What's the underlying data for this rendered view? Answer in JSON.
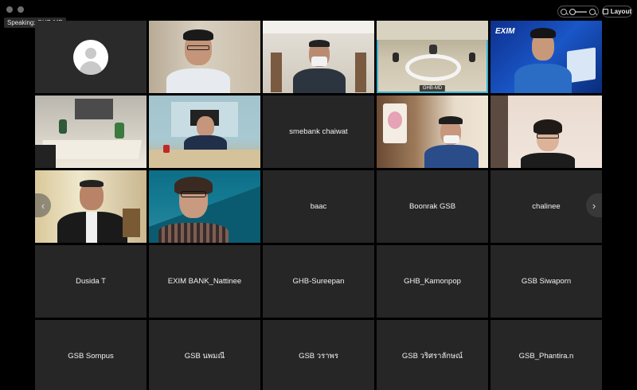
{
  "speaking_indicator": "Speaking: GHB-MD",
  "toolbar": {
    "layout_label": "Layout"
  },
  "tiles": [
    {
      "name": ""
    },
    {
      "name": ""
    },
    {
      "name": ""
    },
    {
      "name": "GHB-MD"
    },
    {
      "name": ""
    },
    {
      "name": ""
    },
    {
      "name": ""
    },
    {
      "name": "smebank chaiwat"
    },
    {
      "name": ""
    },
    {
      "name": ""
    },
    {
      "name": ""
    },
    {
      "name": ""
    },
    {
      "name": "baac"
    },
    {
      "name": "Boonrak GSB"
    },
    {
      "name": "chalinee"
    },
    {
      "name": "Dusida T"
    },
    {
      "name": "EXIM BANK_Nattinee"
    },
    {
      "name": "GHB-Sureepan"
    },
    {
      "name": "GHB_Kamonpop"
    },
    {
      "name": "GSB Siwaporn"
    },
    {
      "name": "GSB Sompus"
    },
    {
      "name": "GSB นพมณี"
    },
    {
      "name": "GSB วราพร"
    },
    {
      "name": "GSB วริศราลักษณ์"
    },
    {
      "name": "GSB_Phantira.n"
    }
  ],
  "logo_text": "EXIM",
  "colors": {
    "active_border": "#3ab4d6",
    "tile_bg": "#262626"
  },
  "nav": {
    "prev_icon": "chevron-left-icon",
    "next_icon": "chevron-right-icon"
  }
}
